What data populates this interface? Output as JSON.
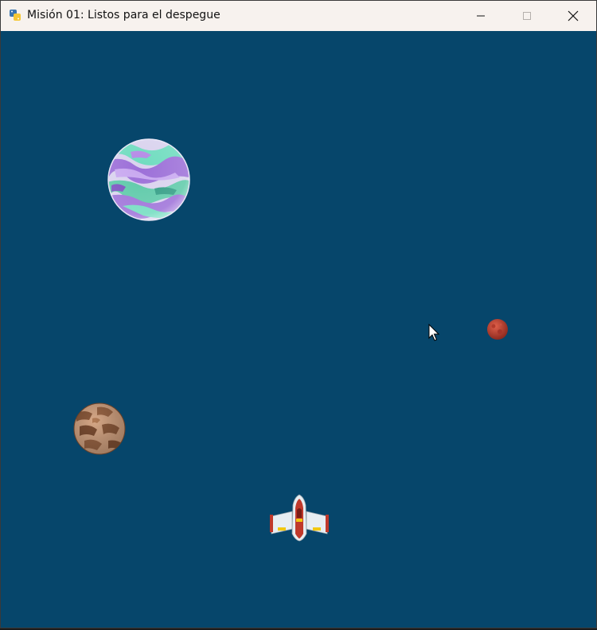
{
  "window": {
    "title": "Misión 01: Listos para el despegue",
    "app_icon": "python-icon",
    "controls": [
      "minimize-icon",
      "maximize-icon",
      "close-icon"
    ]
  },
  "scene": {
    "background_color": "#06466b",
    "sprites": [
      {
        "name": "purple-green-planet",
        "icon": "planet-icon",
        "colors": [
          "#9b6fd6",
          "#5fd4b0",
          "#d6d0ee"
        ]
      },
      {
        "name": "red-planet",
        "icon": "planet-icon",
        "colors": [
          "#c0392b",
          "#8e2a20"
        ]
      },
      {
        "name": "brown-planet",
        "icon": "planet-icon",
        "colors": [
          "#c9997a",
          "#8b5a3c"
        ]
      },
      {
        "name": "player-spaceship",
        "icon": "spaceship-icon",
        "colors": [
          "#c0392b",
          "#e8eef2",
          "#f2c811"
        ]
      },
      {
        "name": "mouse-cursor",
        "icon": "arrow-cursor-icon",
        "colors": [
          "#ffffff",
          "#000000"
        ]
      }
    ]
  }
}
